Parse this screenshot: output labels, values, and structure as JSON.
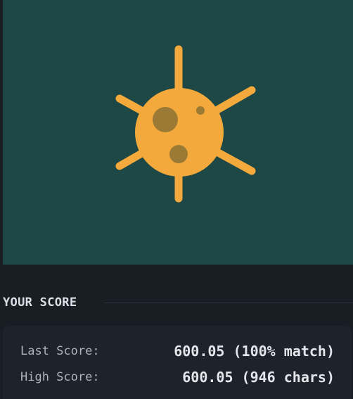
{
  "canvas": {
    "background": "#1e4845",
    "illustration": "virus-icon",
    "illustration_color": "#f3a93b",
    "spot_color": "#9a7a34"
  },
  "score": {
    "title": "YOUR SCORE",
    "last_label": "Last Score:",
    "last_value": "600.05 (100% match)",
    "high_label": "High Score:",
    "high_value": "600.05 (946 chars)"
  }
}
